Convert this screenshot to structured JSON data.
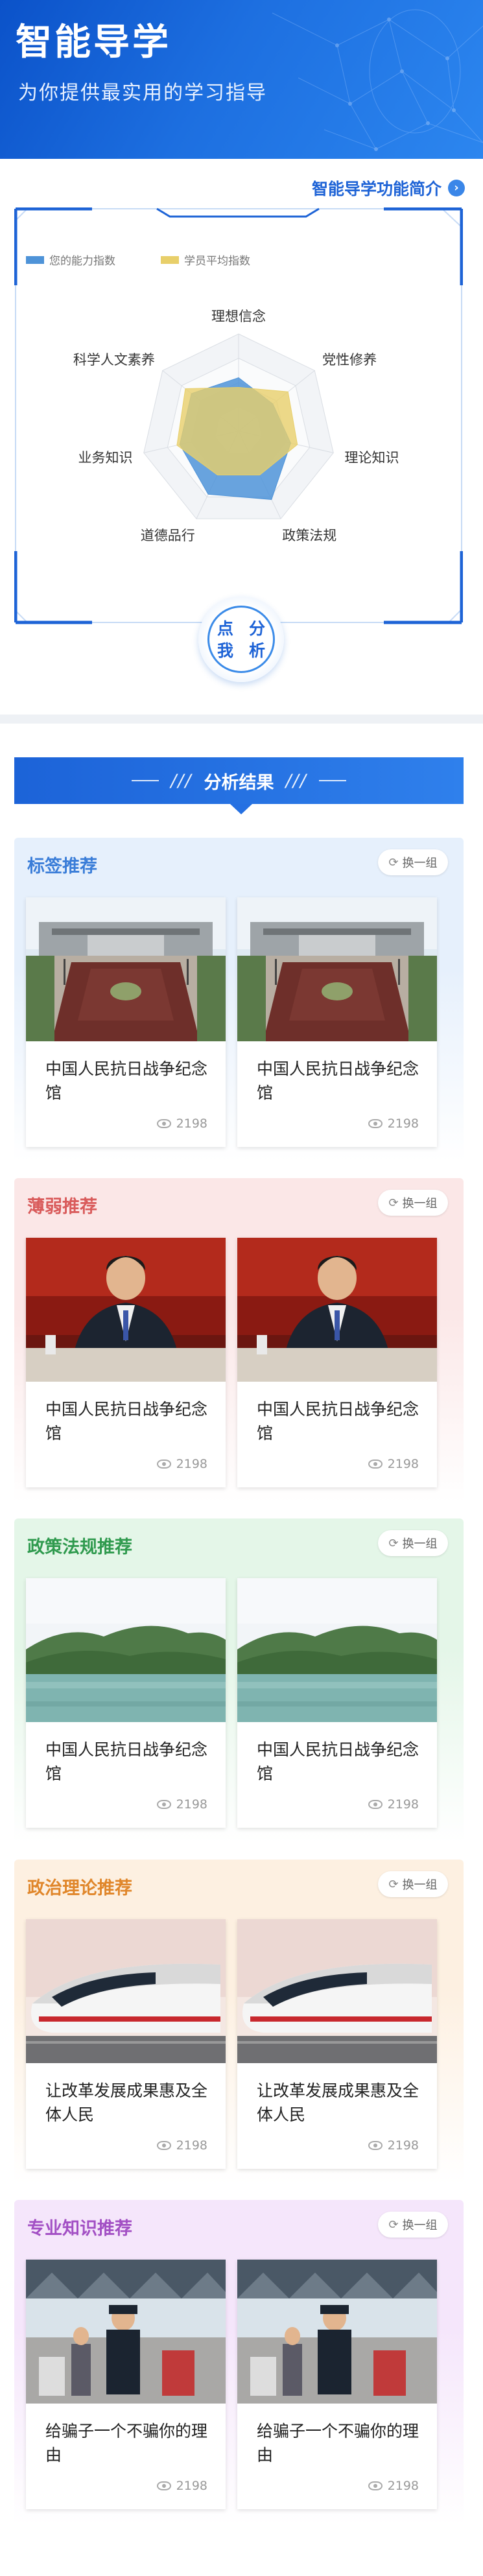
{
  "header": {
    "title": "智能导学",
    "subtitle": "为你提供最实用的学习指导"
  },
  "intro_link": {
    "label": "智能导学功能简介",
    "icon": "info-icon"
  },
  "radar": {
    "legend": [
      {
        "name": "您的能力指数",
        "color": "#4e93d8"
      },
      {
        "name": "学员平均指数",
        "color": "#e8cf6a"
      }
    ],
    "axes": [
      "理想信念",
      "党性修养",
      "理论知识",
      "政策法规",
      "道德品行",
      "业务知识",
      "科学人文素养"
    ],
    "series": [
      {
        "name": "您的能力指数",
        "values": [
          0.55,
          0.45,
          0.55,
          0.78,
          0.72,
          0.62,
          0.62
        ]
      },
      {
        "name": "学员平均指数",
        "values": [
          0.45,
          0.65,
          0.62,
          0.5,
          0.5,
          0.65,
          0.7
        ]
      }
    ]
  },
  "analyze_button": {
    "line1": "点我",
    "line2": "分析"
  },
  "results_bar": {
    "label": "分析结果",
    "deco": "///"
  },
  "sections": [
    {
      "title": "标签推荐",
      "swap": "换一组",
      "title_color": "#3a7dd8",
      "bg": "#e6f0fc",
      "thumb": "memorial",
      "cards": [
        {
          "title": "中国人民抗日战争纪念馆",
          "views": "2198"
        },
        {
          "title": "中国人民抗日战争纪念馆",
          "views": "2198"
        }
      ]
    },
    {
      "title": "薄弱推荐",
      "swap": "换一组",
      "title_color": "#d95b5b",
      "bg": "#fbe7e7",
      "thumb": "speaker",
      "cards": [
        {
          "title": "中国人民抗日战争纪念馆",
          "views": "2198"
        },
        {
          "title": "中国人民抗日战争纪念馆",
          "views": "2198"
        }
      ]
    },
    {
      "title": "政策法规推荐",
      "swap": "换一组",
      "title_color": "#2f9a4e",
      "bg": "#e4f6e8",
      "thumb": "landscape",
      "cards": [
        {
          "title": "中国人民抗日战争纪念馆",
          "views": "2198"
        },
        {
          "title": "中国人民抗日战争纪念馆",
          "views": "2198"
        }
      ]
    },
    {
      "title": "政治理论推荐",
      "swap": "换一组",
      "title_color": "#e0862a",
      "bg": "#fdf0e1",
      "thumb": "train",
      "cards": [
        {
          "title": "让改革发展成果惠及全体人民",
          "views": "2198"
        },
        {
          "title": "让改革发展成果惠及全体人民",
          "views": "2198"
        }
      ]
    },
    {
      "title": "专业知识推荐",
      "swap": "换一组",
      "title_color": "#a24fc4",
      "bg": "#f5e6fb",
      "thumb": "event",
      "cards": [
        {
          "title": "给骗子一个不骗你的理由",
          "views": "2198"
        },
        {
          "title": "给骗子一个不骗你的理由",
          "views": "2198"
        }
      ]
    }
  ]
}
